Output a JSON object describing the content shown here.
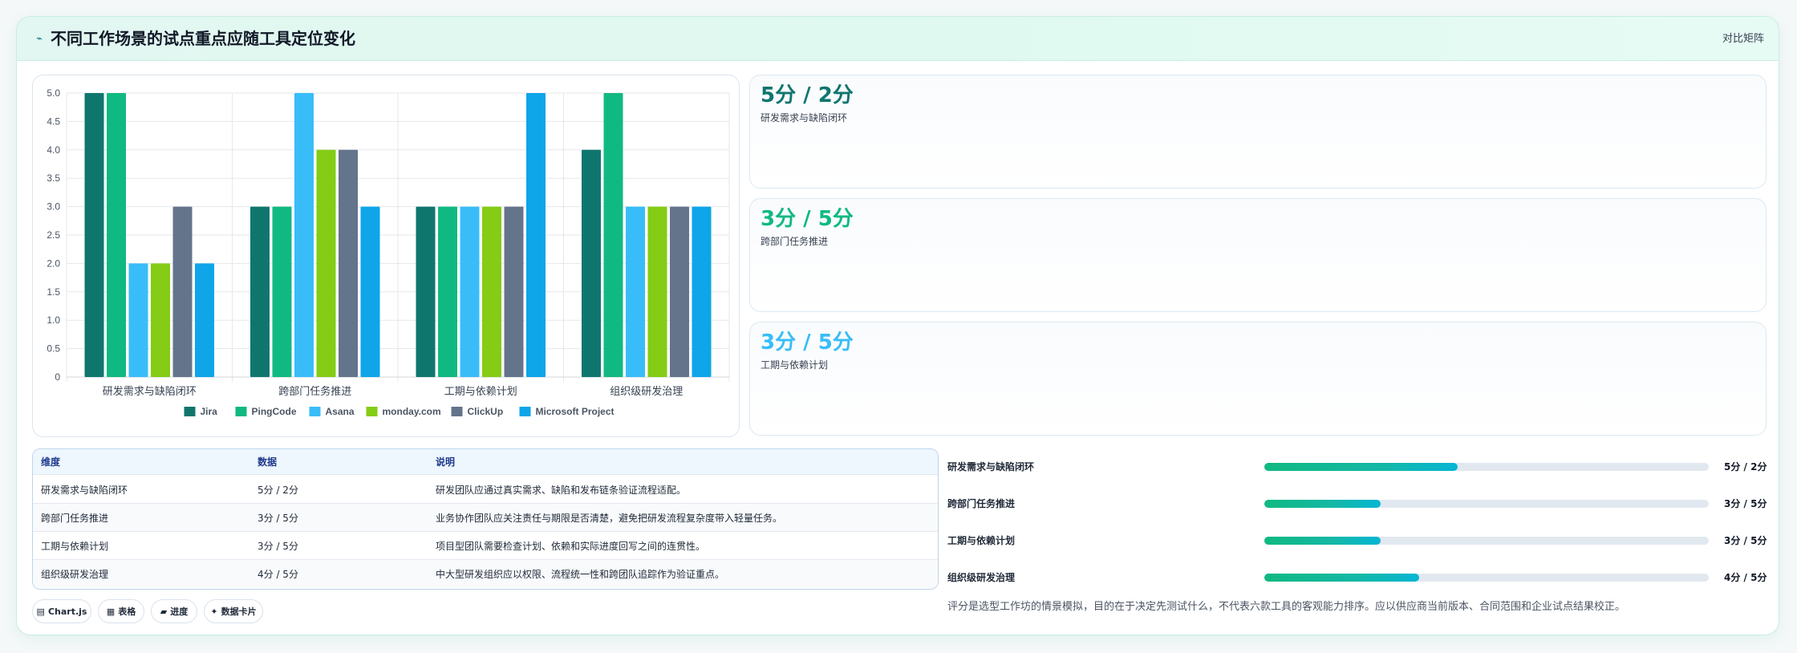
{
  "header": {
    "title": "不同工作场景的试点重点应随工具定位变化",
    "tag": "对比矩阵",
    "icon": "trend-icon"
  },
  "colors": {
    "Jira": "#0f766e",
    "PingCode": "#10b981",
    "Asana": "#38bdf8",
    "monday.com": "#84cc16",
    "ClickUp": "#64748b",
    "Microsoft Project": "#0ea5e9"
  },
  "chart_data": {
    "type": "bar",
    "categories": [
      "研发需求与缺陷闭环",
      "跨部门任务推进",
      "工期与依赖计划",
      "组织级研发治理"
    ],
    "series": [
      {
        "name": "Jira",
        "values": [
          5,
          3,
          3,
          4
        ],
        "color": "#0f766e"
      },
      {
        "name": "PingCode",
        "values": [
          5,
          3,
          3,
          5
        ],
        "color": "#10b981"
      },
      {
        "name": "Asana",
        "values": [
          2,
          5,
          3,
          3
        ],
        "color": "#38bdf8"
      },
      {
        "name": "monday.com",
        "values": [
          2,
          4,
          3,
          3
        ],
        "color": "#84cc16"
      },
      {
        "name": "ClickUp",
        "values": [
          3,
          4,
          3,
          3
        ],
        "color": "#64748b"
      },
      {
        "name": "Microsoft Project",
        "values": [
          2,
          3,
          5,
          3
        ],
        "color": "#0ea5e9"
      }
    ],
    "yticks": [
      "5.0",
      "4.5",
      "4.0",
      "3.5",
      "3.0",
      "2.5",
      "2.0",
      "1.5",
      "1.0",
      "0.5",
      "0"
    ],
    "ylim": [
      0,
      5
    ],
    "grid": true,
    "legend_position": "bottom"
  },
  "stats": [
    {
      "value": "5分 / 2分",
      "label": "研发需求与缺陷闭环",
      "color": "#0f766e"
    },
    {
      "value": "3分 / 5分",
      "label": "跨部门任务推进",
      "color": "#10b981"
    },
    {
      "value": "3分 / 5分",
      "label": "工期与依赖计划",
      "color": "#38bdf8"
    }
  ],
  "table": {
    "headers": [
      "维度",
      "数据",
      "说明"
    ],
    "rows": [
      [
        "研发需求与缺陷闭环",
        "5分 / 2分",
        "研发团队应通过真实需求、缺陷和发布链条验证流程适配。"
      ],
      [
        "跨部门任务推进",
        "3分 / 5分",
        "业务协作团队应关注责任与期限是否清楚，避免把研发流程复杂度带入轻量任务。"
      ],
      [
        "工期与依赖计划",
        "3分 / 5分",
        "项目型团队需要检查计划、依赖和实际进度回写之间的连贯性。"
      ],
      [
        "组织级研发治理",
        "4分 / 5分",
        "中大型研发组织应以权限、流程统一性和跨团队追踪作为验证重点。"
      ]
    ]
  },
  "chips": [
    {
      "icon": "chart-icon",
      "glyph": "▤",
      "label": "Chart.js"
    },
    {
      "icon": "table-icon",
      "glyph": "▦",
      "label": "表格"
    },
    {
      "icon": "progress-icon",
      "glyph": "▰",
      "label": "进度"
    },
    {
      "icon": "card-icon",
      "glyph": "✦",
      "label": "数据卡片"
    }
  ],
  "progress": [
    {
      "label": "研发需求与缺陷闭环",
      "value": "5分 / 2分",
      "fraction": 0.435
    },
    {
      "label": "跨部门任务推进",
      "value": "3分 / 5分",
      "fraction": 0.262
    },
    {
      "label": "工期与依赖计划",
      "value": "3分 / 5分",
      "fraction": 0.262
    },
    {
      "label": "组织级研发治理",
      "value": "4分 / 5分",
      "fraction": 0.349
    }
  ],
  "note": "评分是选型工作坊的情景模拟，目的在于决定先测试什么，不代表六款工具的客观能力排序。应以供应商当前版本、合同范围和企业试点结果校正。"
}
